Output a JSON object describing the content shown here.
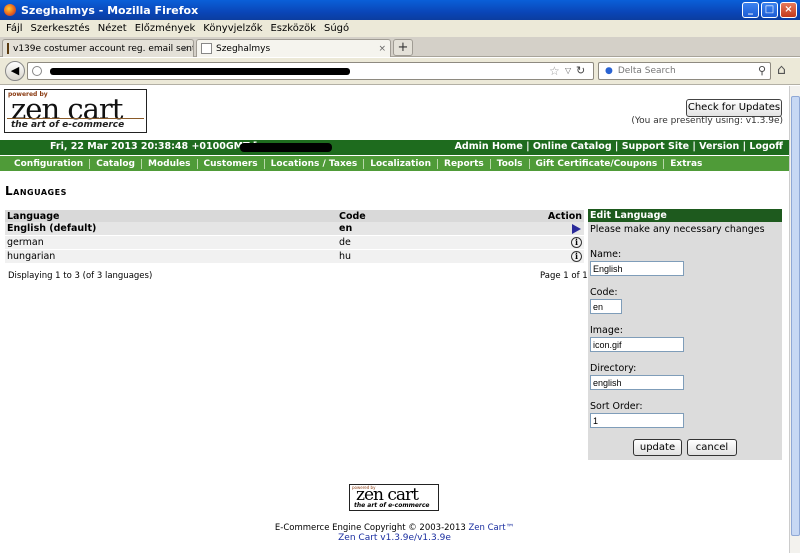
{
  "window": {
    "title": "Szeghalmys - Mozilla Firefox"
  },
  "menubar": [
    "Fájl",
    "Szerkesztés",
    "Nézet",
    "Előzmények",
    "Könyvjelzők",
    "Eszközök",
    "Súgó"
  ],
  "tabs": [
    {
      "label": "v139e costumer account reg. email sent i...",
      "close": "×"
    },
    {
      "label": "Szeghalmys",
      "close": "×"
    }
  ],
  "nav": {
    "search_placeholder": "Delta Search"
  },
  "header": {
    "logo_powered": "powered by",
    "logo_name": "zen cart",
    "logo_tagline": "the art of e-commerce",
    "check_updates": "Check for Updates",
    "version_note": "(You are presently using: v1.3.9e)",
    "date": "Fri, 22 Mar 2013 20:38:48 +0100GMT [",
    "links": "Admin Home | Online Catalog | Support Site | Version | Logoff"
  },
  "menu": [
    "Configuration",
    "Catalog",
    "Modules",
    "Customers",
    "Locations / Taxes",
    "Localization",
    "Reports",
    "Tools",
    "Gift Certificate/Coupons",
    "Extras"
  ],
  "page_title": "Languages",
  "table": {
    "headers": {
      "language": "Language",
      "code": "Code",
      "action": "Action"
    },
    "rows": [
      {
        "language": "English (default)",
        "code": "en"
      },
      {
        "language": "german",
        "code": "de"
      },
      {
        "language": "hungarian",
        "code": "hu"
      }
    ],
    "info_glyph": "i",
    "displaying": "Displaying 1 to 3 (of 3 languages)",
    "page": "Page 1 of 1"
  },
  "edit": {
    "title": "Edit Language",
    "note": "Please make any necessary changes",
    "name_label": "Name:",
    "name_value": "English",
    "code_label": "Code:",
    "code_value": "en",
    "image_label": "Image:",
    "image_value": "icon.gif",
    "directory_label": "Directory:",
    "directory_value": "english",
    "sort_label": "Sort Order:",
    "sort_value": "1",
    "update": "update",
    "cancel": "cancel"
  },
  "footer": {
    "logo_powered": "powered by",
    "logo_name": "zen cart",
    "logo_tagline": "the art of e-commerce",
    "copyright": "E-Commerce Engine Copyright © 2003-2013 ",
    "copyright_link": "Zen Cart™",
    "version": "Zen Cart v1.3.9e/v1.3.9e"
  }
}
